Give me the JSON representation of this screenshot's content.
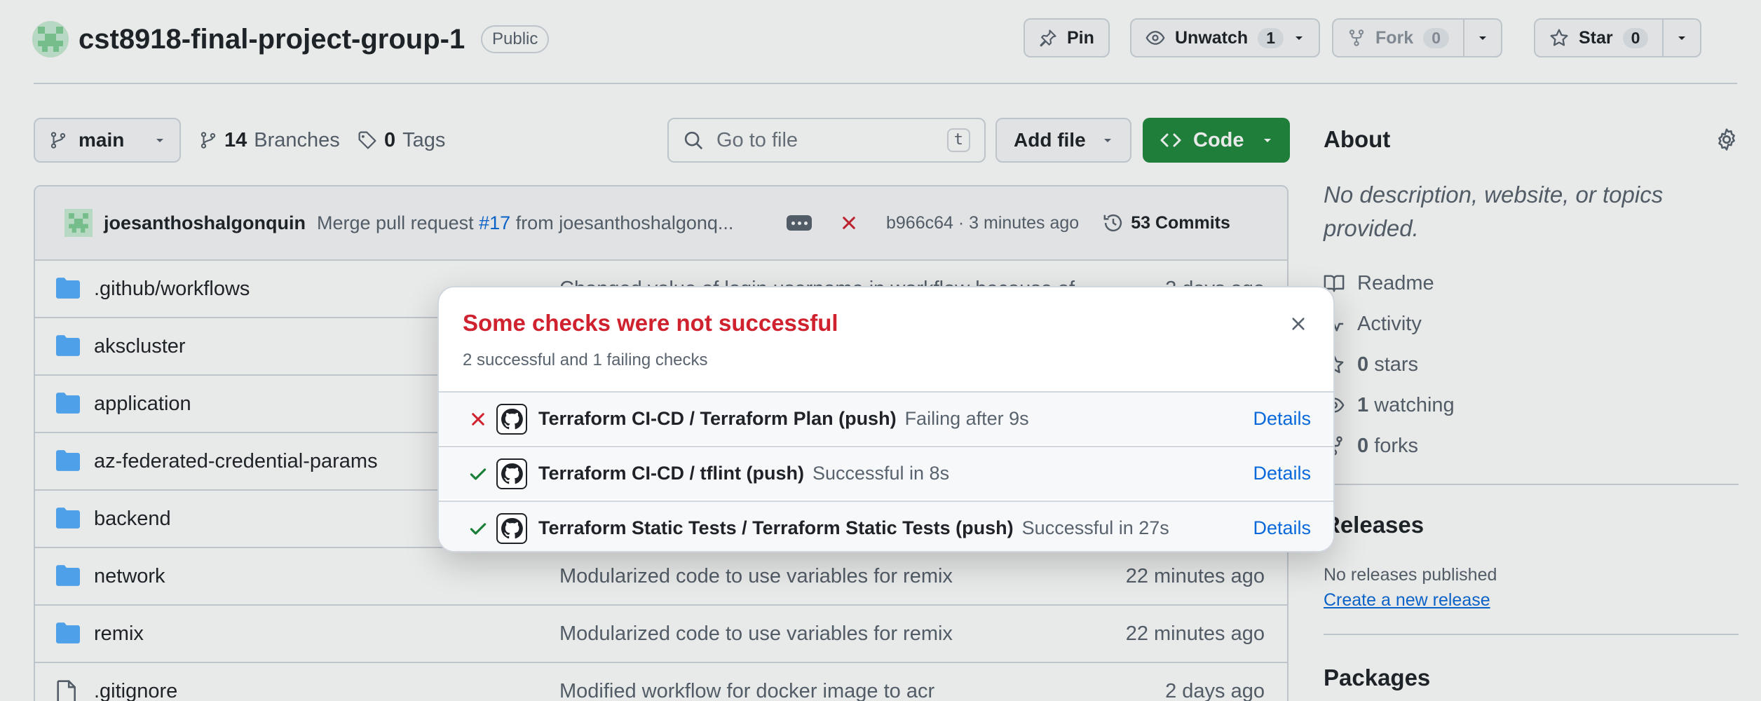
{
  "header": {
    "repo_name": "cst8918-final-project-group-1",
    "visibility": "Public",
    "pin_label": "Pin",
    "unwatch_label": "Unwatch",
    "unwatch_count": "1",
    "fork_label": "Fork",
    "fork_count": "0",
    "star_label": "Star",
    "star_count": "0"
  },
  "toolbar": {
    "branch": "main",
    "branches_count": "14",
    "branches_label": "Branches",
    "tags_count": "0",
    "tags_label": "Tags",
    "search_placeholder": "Go to file",
    "search_shortcut": "t",
    "add_file_label": "Add file",
    "code_label": "Code"
  },
  "latest_commit": {
    "author": "joesanthoshalgonquin",
    "message_prefix": "Merge pull request ",
    "pr_link": "#17",
    "message_suffix": " from joesanthoshalgonq...",
    "sha_time": "b966c64 · 3 minutes ago",
    "commits_label": "53 Commits"
  },
  "files": [
    {
      "name": ".github/workflows",
      "type": "folder",
      "message": "Changed value of login username in workflow because of",
      "age": "2 days ago"
    },
    {
      "name": "akscluster",
      "type": "folder",
      "message": "",
      "age": ""
    },
    {
      "name": "application",
      "type": "folder",
      "message": "",
      "age": ""
    },
    {
      "name": "az-federated-credential-params",
      "type": "folder",
      "message": "",
      "age": ""
    },
    {
      "name": "backend",
      "type": "folder",
      "message": "",
      "age": ""
    },
    {
      "name": "network",
      "type": "folder",
      "message": "Modularized code to use variables for remix",
      "age": "22 minutes ago"
    },
    {
      "name": "remix",
      "type": "folder",
      "message": "Modularized code to use variables for remix",
      "age": "22 minutes ago"
    },
    {
      "name": ".gitignore",
      "type": "file",
      "message": "Modified workflow for docker image to acr",
      "age": "2 days ago"
    }
  ],
  "sidebar": {
    "about_title": "About",
    "description": "No description, website, or topics provided.",
    "readme": "Readme",
    "activity": "Activity",
    "stars_count": "0",
    "stars_label": "stars",
    "watching_count": "1",
    "watching_label": "watching",
    "forks_count": "0",
    "forks_label": "forks",
    "releases_title": "Releases",
    "releases_none": "No releases published",
    "create_release": "Create a new release",
    "packages_title": "Packages"
  },
  "checks_popover": {
    "title": "Some checks were not successful",
    "summary": "2 successful and 1 failing checks",
    "checks": [
      {
        "name": "Terraform CI-CD / Terraform Plan (push)",
        "detail": "Failing after 9s",
        "status": "failure",
        "link": "Details"
      },
      {
        "name": "Terraform CI-CD / tflint (push)",
        "detail": "Successful in 8s",
        "status": "success",
        "link": "Details"
      },
      {
        "name": "Terraform Static Tests / Terraform Static Tests (push)",
        "detail": "Successful in 27s",
        "status": "success",
        "link": "Details"
      }
    ]
  },
  "colors": {
    "accent_link": "#0969da",
    "success_green": "#1a7f37",
    "failure_red": "#cf222e",
    "code_button": "#1f883d",
    "folder_blue": "#54aeff"
  }
}
